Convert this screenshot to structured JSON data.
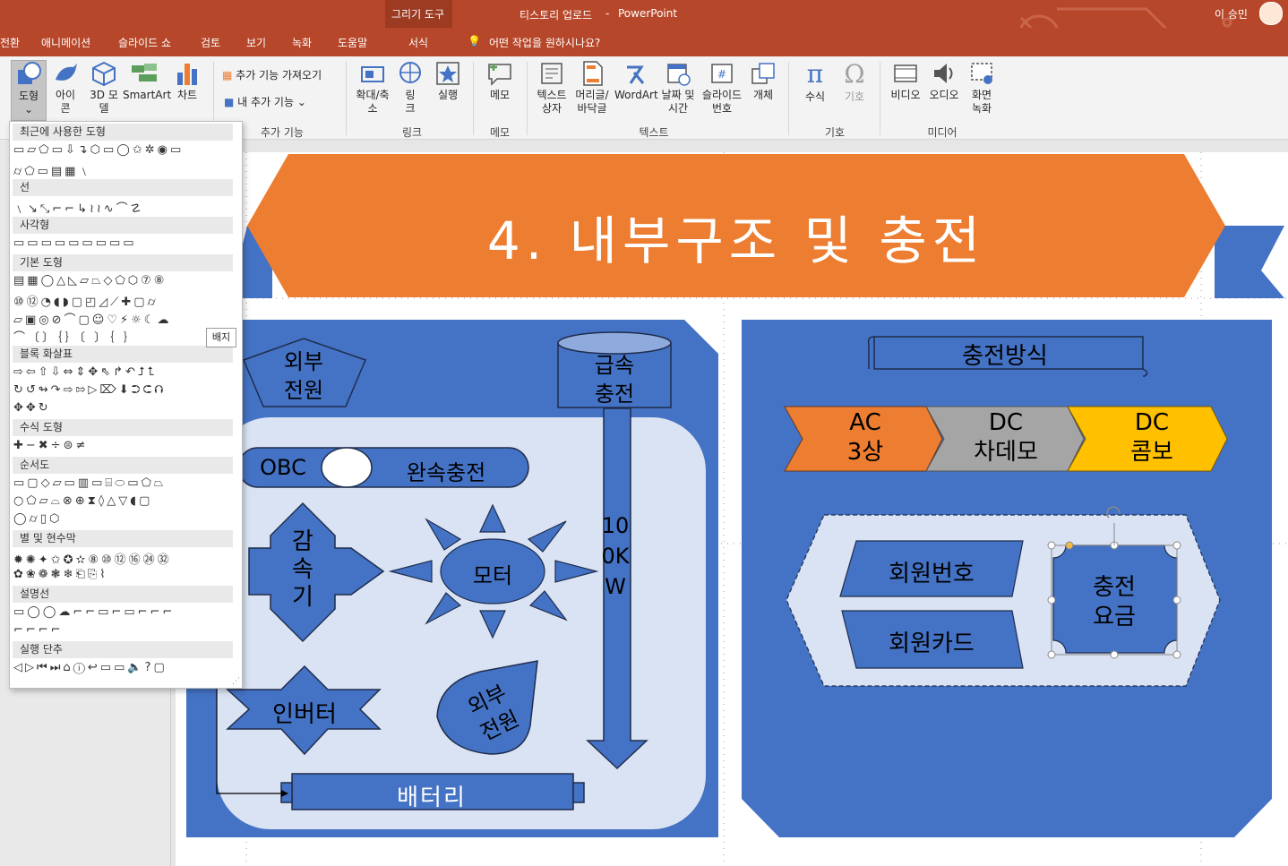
{
  "titlebar": {
    "context_group": "그리기 도구",
    "document_title": "티스토리 업로드",
    "dash": "-",
    "app_name": "PowerPoint",
    "user_name": "이 승민"
  },
  "tabs": [
    "전환",
    "애니메이션",
    "슬라이드 쇼",
    "검토",
    "보기",
    "녹화",
    "도움말",
    "서식"
  ],
  "tell_me": "어떤 작업을 원하시나요?",
  "ribbon": {
    "illustrations": [
      "도형",
      "아이콘",
      "3D 모델",
      "SmartArt",
      "차트"
    ],
    "addins": {
      "get": "추가 기능 가져오기",
      "mine": "내 추가 기능",
      "label": "추가 기능"
    },
    "links": {
      "zoom": "확대/축소",
      "link": "링크",
      "action": "실행",
      "label": "링크"
    },
    "comments": {
      "comment": "메모",
      "label": "메모"
    },
    "text": {
      "textbox": "텍스트 상자",
      "header": "머리글/바닥글",
      "wordart": "WordArt",
      "datetime": "날짜 및 시간",
      "slidenum": "슬라이드 번호",
      "object": "개체",
      "label": "텍스트"
    },
    "symbols": {
      "equation": "수식",
      "symbol": "기호",
      "label": "기호"
    },
    "media": {
      "video": "비디오",
      "audio": "오디오",
      "record": "화면 녹화",
      "label": "미디어"
    }
  },
  "shapes_panel": {
    "categories": [
      "최근에 사용한 도형",
      "선",
      "사각형",
      "기본 도형",
      "블록 화살표",
      "수식 도형",
      "순서도",
      "별 및 현수막",
      "설명선",
      "실행 단추"
    ],
    "tooltip": "배지"
  },
  "slide": {
    "title": "4. 내부구조 및 충전",
    "left": {
      "outer_power_top": "외부\n전원",
      "fast_charge": "급속\n충전",
      "obc": "OBC",
      "slow_charge": "완속충전",
      "reducer": "감\n속\n기",
      "motor": "모터",
      "power_100kw": "100KW",
      "inverter": "인버터",
      "outer_power_bottom": "외부\n전원",
      "battery": "배터리"
    },
    "right": {
      "charge_method": "충전방식",
      "chev1": "AC\n3상",
      "chev2": "DC\n차데모",
      "chev3": "DC\n콤보",
      "member_no": "회원번호",
      "member_card": "회원카드",
      "fee": "충전\n요금"
    }
  },
  "colors": {
    "accent": "#b7472a",
    "blue": "#4472c4",
    "orange": "#ed7d31",
    "light": "#dae3f3",
    "gray": "#a5a5a5",
    "gold": "#ffc000"
  }
}
